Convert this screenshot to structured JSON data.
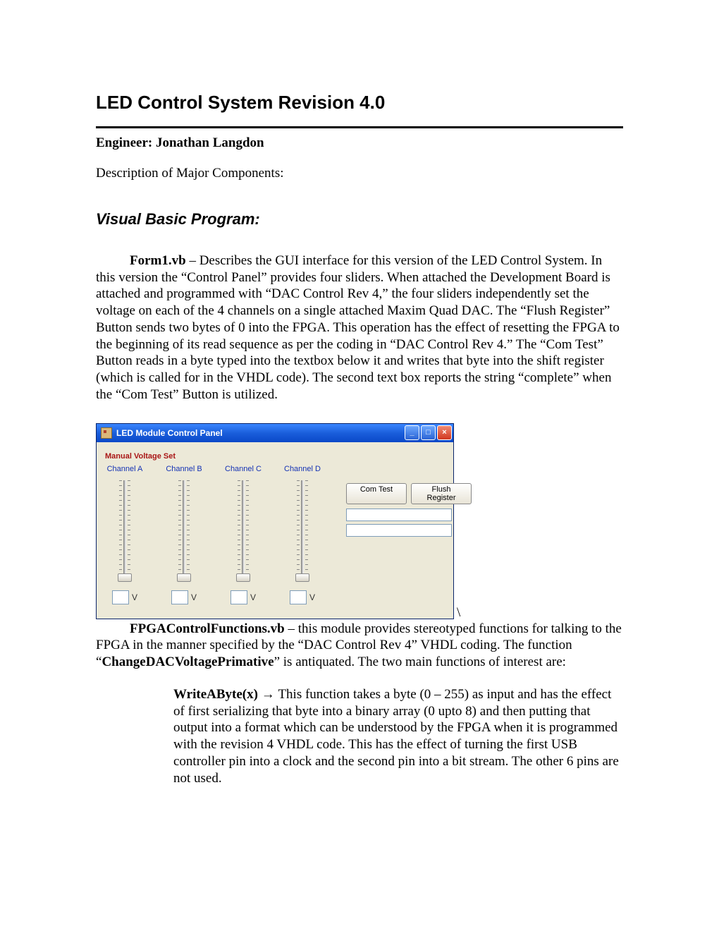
{
  "title": "LED Control System Revision 4.0",
  "engineer_line": "Engineer: Jonathan Langdon",
  "desc_line": "Description of Major Components:",
  "section_vb": "Visual Basic Program:",
  "p1": {
    "lead": "Form1.vb",
    "body": " – Describes the GUI interface for this version of the LED Control System. In this version the “Control Panel” provides four sliders. When attached the Development Board is attached and programmed with “DAC Control Rev 4,” the four sliders independently set the voltage on each of the 4 channels on a single attached Maxim Quad DAC. The “Flush Register” Button sends two bytes of 0 into the FPGA. This operation has the effect of resetting the FPGA to the beginning of its read sequence as per the coding in “DAC Control Rev 4.” The “Com Test” Button reads in a byte typed into the textbox below it and writes that byte into the shift register (which is called for in the VHDL code). The second text box reports the string “complete” when the “Com Test” Button is utilized."
  },
  "window": {
    "title": "LED Module Control Panel",
    "group_label": "Manual Voltage Set",
    "channels": [
      "Channel A",
      "Channel B",
      "Channel C",
      "Channel D"
    ],
    "unit": "V",
    "buttons": {
      "com_test": "Com Test",
      "flush": "Flush Register"
    }
  },
  "backslash": "\\",
  "p2": {
    "lead": "FPGAControlFunctions.vb",
    "part1": " – this module provides stereotyped functions for talking to the FPGA in the manner specified by the “DAC Control Rev 4” VHDL coding. The function “",
    "bold2": "ChangeDACVoltagePrimative",
    "part2": "” is antiquated. The two main functions of interest are:"
  },
  "func": {
    "name": "WriteAByte(x) → ",
    "body": "This function takes a byte (0 – 255) as input and has the effect of first serializing that byte into a binary array (0 upto 8) and then putting that output into a format which can be understood by the FPGA when it is programmed with the revision 4 VHDL code. This has the effect of turning the first USB controller pin into a clock and the second pin into a bit stream. The other 6 pins are not used."
  }
}
